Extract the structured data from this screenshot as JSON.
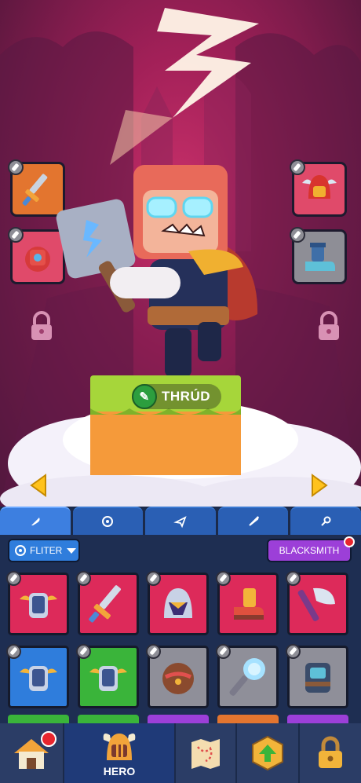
{
  "hero": {
    "name": "THRÚD"
  },
  "equip_slots": [
    {
      "name": "sword",
      "color": "#e06a2e"
    },
    {
      "name": "helmet",
      "color": "#e04a6a"
    },
    {
      "name": "armor",
      "color": "#e04a6a"
    },
    {
      "name": "boots",
      "color": "#8e8e96"
    }
  ],
  "tabs": [
    "weapon-tab",
    "target-tab",
    "plane-tab",
    "sword-tab",
    "key-tab"
  ],
  "toolbar": {
    "filter_label": "FLITER",
    "blacksmith_label": "BLACKSMITH"
  },
  "items_row1": [
    "axe-armor",
    "sword",
    "helmet",
    "boots",
    "axe"
  ],
  "items_row2": [
    "armor-blue",
    "armor-green",
    "bag",
    "mace",
    "chest-armor"
  ],
  "bottom_nav": {
    "hero_label": "HERO"
  },
  "colors": {
    "rarity_red": "#dd2a5a",
    "rarity_blue": "#2f7ddc",
    "rarity_green": "#3ab43a",
    "rarity_gray": "#8f8f99"
  }
}
